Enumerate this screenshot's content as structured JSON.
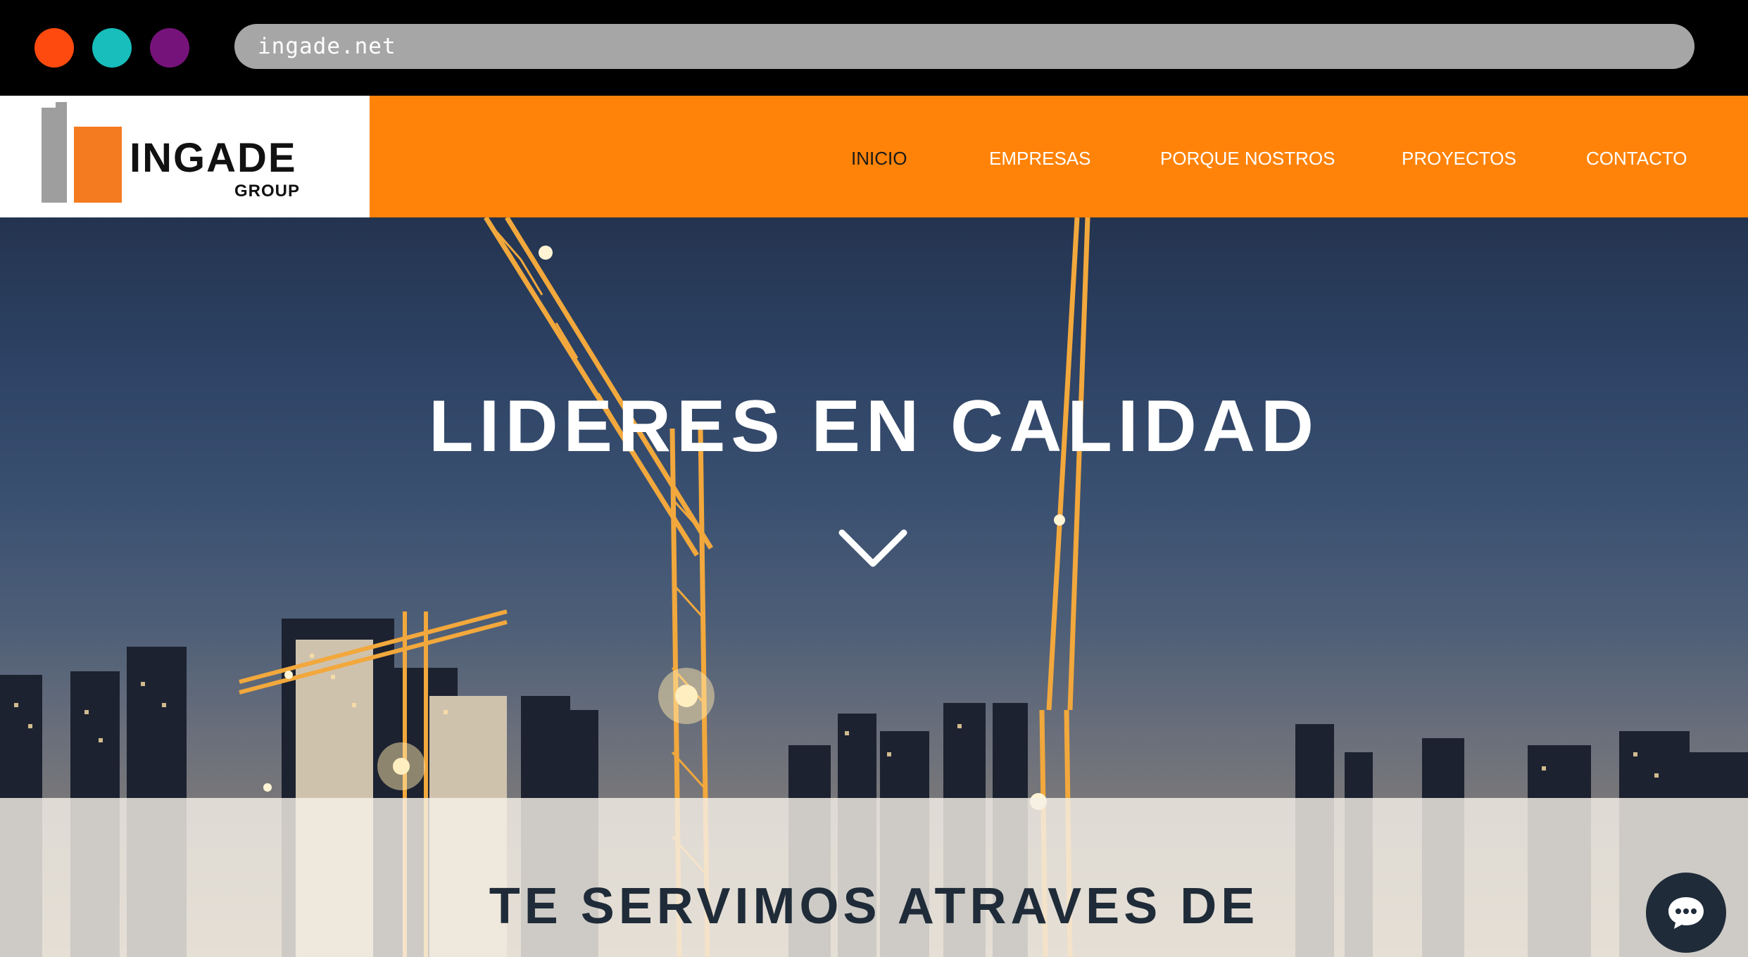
{
  "browser": {
    "url": "ingade.net",
    "window_dots": [
      {
        "name": "close",
        "color": "#ff4a0f"
      },
      {
        "name": "minimize",
        "color": "#17bebb"
      },
      {
        "name": "maximize",
        "color": "#76137a"
      }
    ]
  },
  "logo": {
    "name": "INGADE",
    "sub": "GROUP"
  },
  "nav": {
    "items": [
      {
        "label": "INICIO",
        "active": true
      },
      {
        "label": "EMPRESAS",
        "active": false
      },
      {
        "label": "PORQUE NOSTROS",
        "active": false
      },
      {
        "label": "PROYECTOS",
        "active": false
      },
      {
        "label": "CONTACTO",
        "active": false
      }
    ]
  },
  "hero": {
    "title": "LIDERES EN CALIDAD",
    "scroll_icon": "chevron-down-icon"
  },
  "section": {
    "title": "TE SERVIMOS ATRAVES DE"
  },
  "chat": {
    "icon": "chat-bubble-icon"
  },
  "colors": {
    "nav_bg": "#ff8309",
    "nav_active_text": "#1a1a1a",
    "logo_orange": "#f47b20",
    "logo_gray": "#9e9e9e",
    "dark_navy": "#1f2b38"
  }
}
